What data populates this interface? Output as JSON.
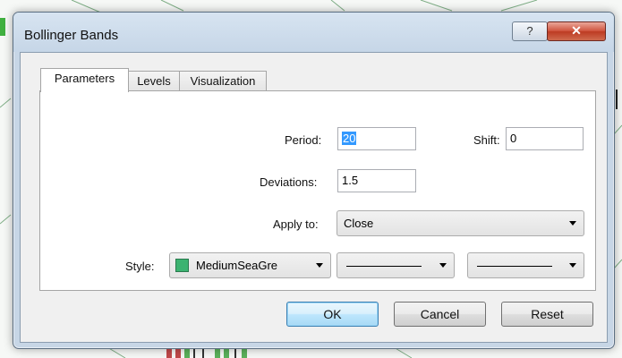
{
  "dialog": {
    "title": "Bollinger Bands",
    "help_glyph": "?",
    "close_glyph": "✕"
  },
  "tabs": [
    {
      "label": "Parameters",
      "active": true
    },
    {
      "label": "Levels",
      "active": false
    },
    {
      "label": "Visualization",
      "active": false
    }
  ],
  "params": {
    "period_label": "Period:",
    "period_value": "20",
    "shift_label": "Shift:",
    "shift_value": "0",
    "deviations_label": "Deviations:",
    "deviations_value": "1.5",
    "apply_label": "Apply to:",
    "apply_value": "Close",
    "style_label": "Style:",
    "style_color_name": "MediumSeaGre",
    "style_color": "#3cb371"
  },
  "buttons": {
    "ok": "OK",
    "cancel": "Cancel",
    "reset": "Reset"
  }
}
